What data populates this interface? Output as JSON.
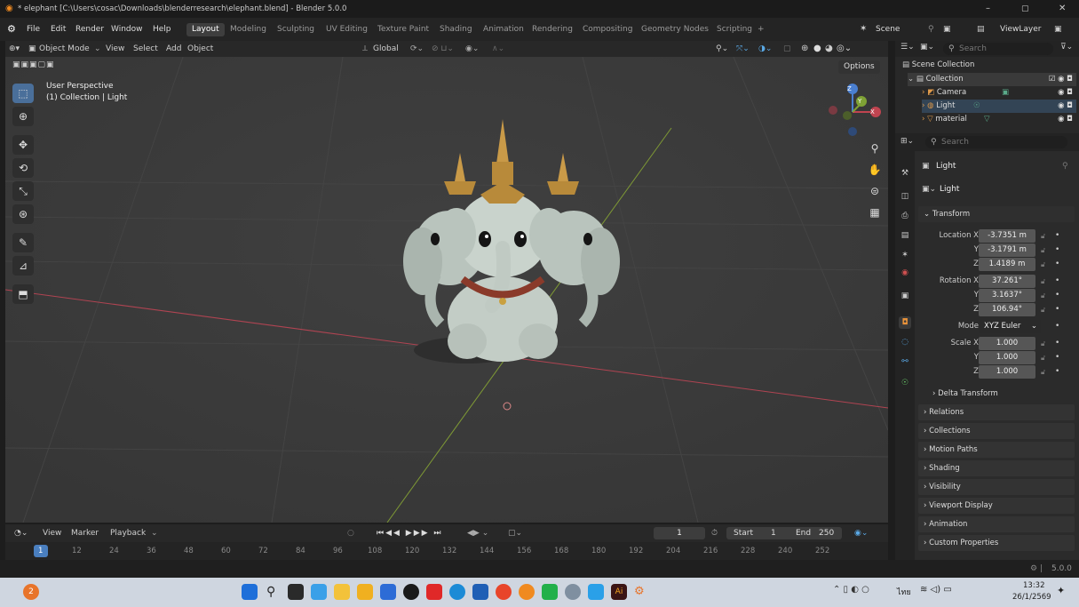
{
  "titlebar": {
    "text": "* elephant [C:\\Users\\cosac\\Downloads\\blenderresearch\\elephant.blend] - Blender 5.0.0",
    "min": "–",
    "max": "▢",
    "close": "✕"
  },
  "menu": [
    "File",
    "Edit",
    "Render",
    "Window",
    "Help"
  ],
  "workspaces": [
    "Layout",
    "Modeling",
    "Sculpting",
    "UV Editing",
    "Texture Paint",
    "Shading",
    "Animation",
    "Rendering",
    "Compositing",
    "Geometry Nodes",
    "Scripting",
    "+"
  ],
  "scene": {
    "label": "Scene",
    "viewlayer": "ViewLayer"
  },
  "viewport_header": {
    "mode": "Object Mode",
    "view": "View",
    "select": "Select",
    "add": "Add",
    "object": "Object",
    "orientation": "Global",
    "options": "Options"
  },
  "viewport": {
    "perspective": "User Perspective",
    "collection": "(1) Collection | Light",
    "gizmo_axes": [
      "X",
      "Y",
      "Z"
    ]
  },
  "outliner": {
    "search_placeholder": "Search",
    "items": [
      {
        "label": "Scene Collection"
      },
      {
        "label": "Collection"
      },
      {
        "label": "Camera"
      },
      {
        "label": "Light"
      },
      {
        "label": "material"
      }
    ]
  },
  "properties": {
    "search_placeholder": "Search",
    "object_name": "Light",
    "data_name": "Light",
    "transform_title": "Transform",
    "location": {
      "label": "Location X",
      "x": "-3.7351 m",
      "y": "-3.1791 m",
      "z": "1.4189 m"
    },
    "rotation": {
      "label": "Rotation X",
      "x": "37.261°",
      "y": "3.1637°",
      "z": "106.94°"
    },
    "mode_label": "Mode",
    "mode_value": "XYZ Euler",
    "scale": {
      "label": "Scale X",
      "x": "1.000",
      "y": "1.000",
      "z": "1.000"
    },
    "axis_y": "Y",
    "axis_z": "Z",
    "panels": [
      "Delta Transform",
      "Relations",
      "Collections",
      "Motion Paths",
      "Shading",
      "Visibility",
      "Viewport Display",
      "Animation",
      "Custom Properties"
    ]
  },
  "timeline": {
    "view": "View",
    "marker": "Marker",
    "playback": "Playback",
    "current_frame": "1",
    "start_label": "Start",
    "start": "1",
    "end_label": "End",
    "end": "250",
    "frames": [
      "1",
      "12",
      "24",
      "36",
      "48",
      "60",
      "72",
      "84",
      "96",
      "108",
      "120",
      "132",
      "144",
      "156",
      "168",
      "180",
      "192",
      "204",
      "216",
      "228",
      "240",
      "252"
    ]
  },
  "status": {
    "version": "5.0.0"
  },
  "taskbar": {
    "lang": "ไทย",
    "time": "13:32",
    "date": "26/1/2569",
    "notif": "2"
  },
  "colors": {
    "accent": "#4a7fbf",
    "active_tab": "#3e3e3e",
    "viewport_bg": "#3c3c3c",
    "x_axis": "#c04450",
    "y_axis": "#8aa23a"
  }
}
